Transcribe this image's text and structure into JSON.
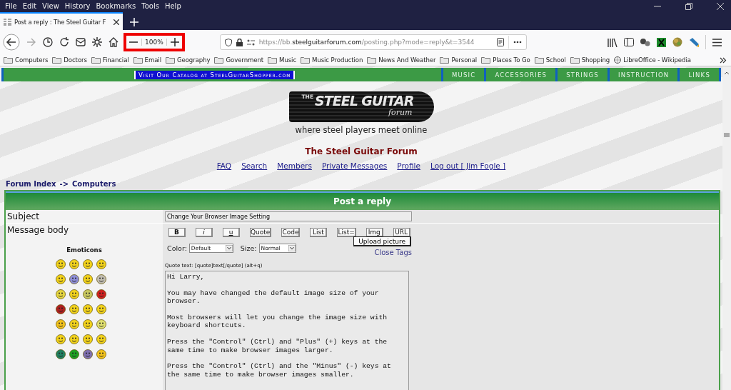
{
  "menu": [
    "File",
    "Edit",
    "View",
    "History",
    "Bookmarks",
    "Tools",
    "Help"
  ],
  "tab": {
    "title": "Post a reply : The Steel Guitar F",
    "selected": true
  },
  "zoom": {
    "reading": "100%",
    "highlighted": true
  },
  "url": {
    "prefix": "https://bb.",
    "domain": "steelguitarforum.com",
    "path": "/posting.php?mode=reply&t=3544"
  },
  "bookmarks": [
    {
      "label": "Computers",
      "kind": "folder"
    },
    {
      "label": "Doctors",
      "kind": "folder"
    },
    {
      "label": "Financial",
      "kind": "folder"
    },
    {
      "label": "Email",
      "kind": "folder"
    },
    {
      "label": "Geography",
      "kind": "folder"
    },
    {
      "label": "Government",
      "kind": "folder"
    },
    {
      "label": "Music",
      "kind": "folder"
    },
    {
      "label": "Music Production",
      "kind": "folder"
    },
    {
      "label": "News And Weather",
      "kind": "folder"
    },
    {
      "label": "Personal",
      "kind": "folder"
    },
    {
      "label": "Places To Go",
      "kind": "folder"
    },
    {
      "label": "School",
      "kind": "folder"
    },
    {
      "label": "Shopping",
      "kind": "folder"
    },
    {
      "label": "LibreOffice - Wikipedia",
      "kind": "page"
    }
  ],
  "site_nav": {
    "catalog": "Visit Our Catalog at SteelGuitarShopper.com",
    "items": [
      "MUSIC",
      "ACCESSORIES",
      "STRINGS",
      "INSTRUCTION",
      "LINKS"
    ]
  },
  "logo": {
    "prefix": "THE",
    "title": "STEEL GUITAR",
    "script": "forum"
  },
  "tagline": "where steel players meet online",
  "forum_title": "The Steel Guitar Forum",
  "links": [
    "FAQ",
    "Search",
    "Members",
    "Private Messages",
    "Profile",
    "Log out [ Jim Fogle ]"
  ],
  "breadcrumb": {
    "root": "Forum Index",
    "separator": "->",
    "current": "Computers"
  },
  "form": {
    "header": "Post a reply",
    "subject_label": "Subject",
    "subject_value": "Change Your Browser Image Setting",
    "body_label": "Message body",
    "emoticons_title": "Emoticons",
    "emoticons": [
      {
        "color": "#f2d21b"
      },
      {
        "color": "#f2d21b"
      },
      {
        "color": "#f2d21b"
      },
      {
        "color": "#f2d21b"
      },
      {
        "color": "#f2d21b"
      },
      {
        "color": "#8e8ed8"
      },
      {
        "color": "#f2d21b"
      },
      {
        "color": "#c0bcb0"
      },
      {
        "color": "#e6d640"
      },
      {
        "color": "#f2d21b"
      },
      {
        "color": "#c8c860"
      },
      {
        "color": "#d02020"
      },
      {
        "color": "#b02020"
      },
      {
        "color": "#f2d21b"
      },
      {
        "color": "#f2d21b"
      },
      {
        "color": "#f2d21b"
      },
      {
        "color": "#f2c21b"
      },
      {
        "color": "#f2d21b"
      },
      {
        "color": "#f2d21b"
      },
      {
        "color": "#e0e070"
      },
      {
        "color": "#f2d21b"
      },
      {
        "color": "#f2d21b"
      },
      {
        "color": "#f2d21b"
      },
      {
        "color": "#f2d21b"
      },
      {
        "color": "#208060"
      },
      {
        "color": "#20a020"
      },
      {
        "color": "#8070b0"
      },
      {
        "color": "#f2c21b"
      }
    ],
    "format_buttons": [
      {
        "label": "B",
        "kind": "bold"
      },
      {
        "label": "i",
        "kind": "italic"
      },
      {
        "label": "u",
        "kind": "underline"
      },
      {
        "label": "Quote",
        "kind": "plain"
      },
      {
        "label": "Code",
        "kind": "plain"
      },
      {
        "label": "List",
        "kind": "plain"
      },
      {
        "label": "List=",
        "kind": "plain"
      },
      {
        "label": "Img",
        "kind": "plain"
      },
      {
        "label": "URL",
        "kind": "plain"
      }
    ],
    "upload_button": "Upload picture",
    "color_label": "Color:",
    "color_value": "Default",
    "size_label": "Size:",
    "size_value": "Normal",
    "close_tags": "Close Tags",
    "hint": "Quote text: [quote]text[/quote]  (alt+q)",
    "message": "Hi Larry,\n\nYou may have changed the default image size of your browser.\n\nMost browsers will let you change the image size with keyboard shortcuts.\n\nPress the \"Control\" (Ctrl) and \"Plus\" (+) keys at the same time to make browser images larger.\n\nPress the \"Control\" (Ctrl) and the \"Minus\" (-) keys at the same time to make browser images smaller."
  }
}
